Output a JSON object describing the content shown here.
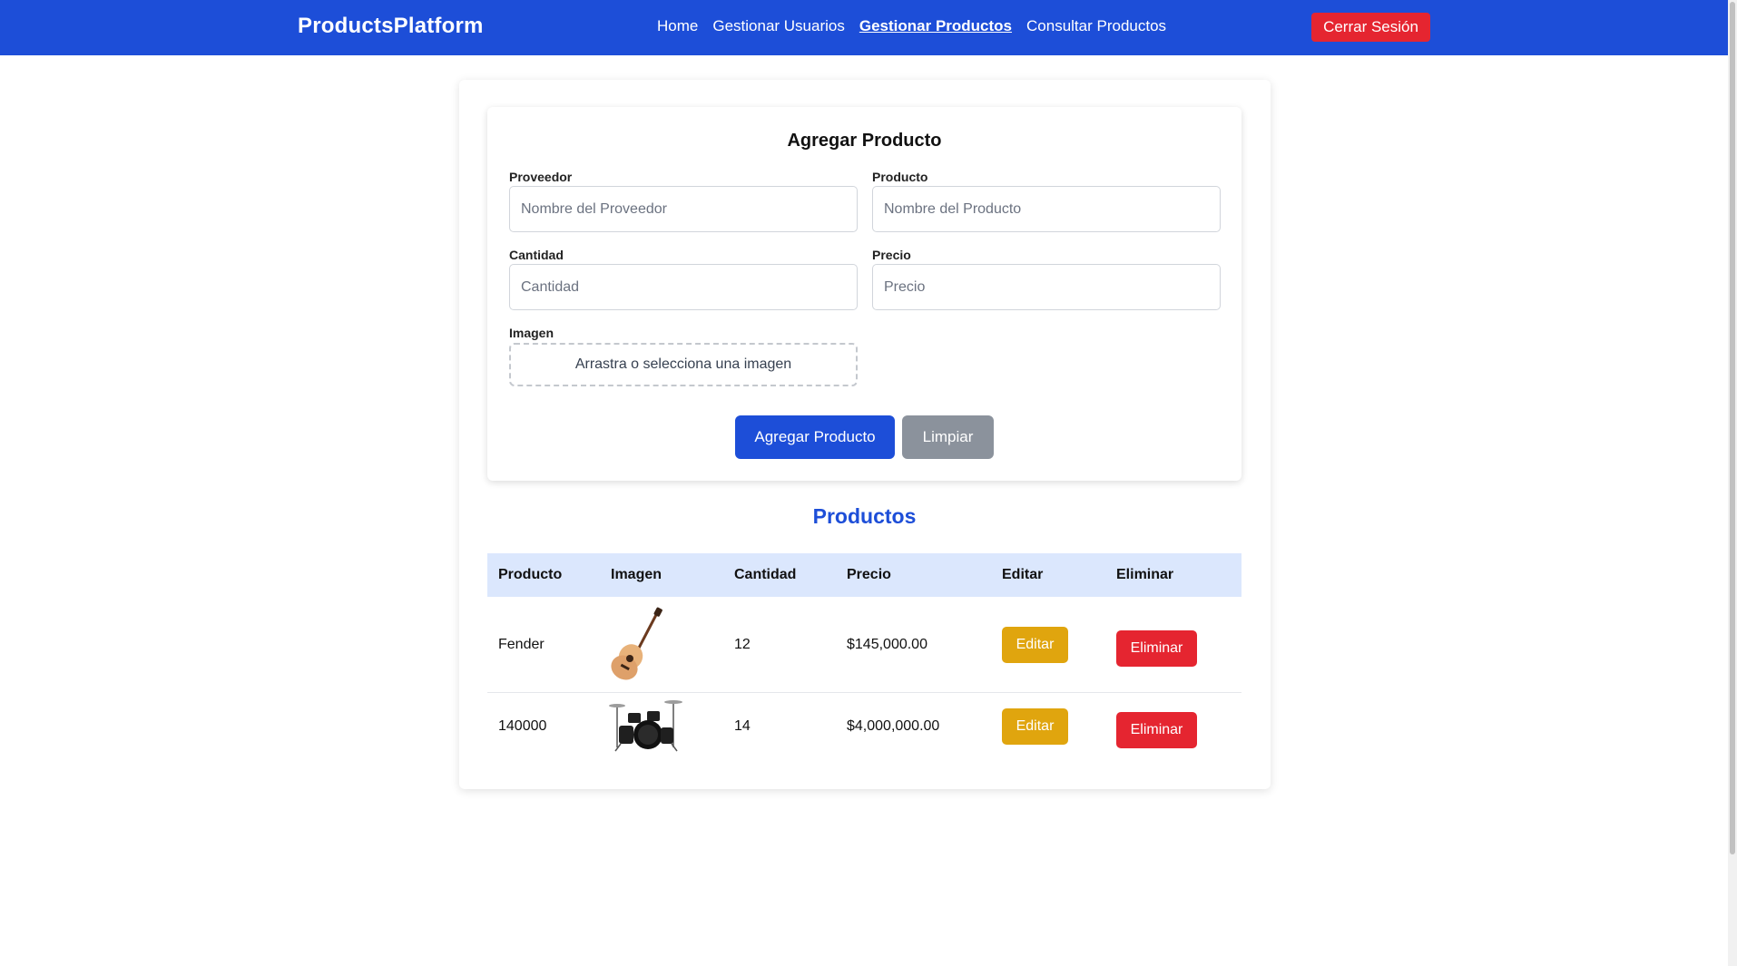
{
  "navbar": {
    "brand": "ProductsPlatform",
    "links": [
      {
        "label": "Home",
        "active": false
      },
      {
        "label": "Gestionar Usuarios",
        "active": false
      },
      {
        "label": "Gestionar Productos",
        "active": true
      },
      {
        "label": "Consultar Productos",
        "active": false
      }
    ],
    "logout_label": "Cerrar Sesión"
  },
  "form": {
    "title": "Agregar Producto",
    "fields": {
      "proveedor": {
        "label": "Proveedor",
        "placeholder": "Nombre del Proveedor",
        "value": ""
      },
      "producto": {
        "label": "Producto",
        "placeholder": "Nombre del Producto",
        "value": ""
      },
      "cantidad": {
        "label": "Cantidad",
        "placeholder": "Cantidad",
        "value": ""
      },
      "precio": {
        "label": "Precio",
        "placeholder": "Precio",
        "value": ""
      },
      "imagen": {
        "label": "Imagen",
        "dropzone_text": "Arrastra o selecciona una imagen"
      }
    },
    "submit_label": "Agregar Producto",
    "clear_label": "Limpiar"
  },
  "products": {
    "title": "Productos",
    "columns": [
      "Producto",
      "Imagen",
      "Cantidad",
      "Precio",
      "Editar",
      "Eliminar"
    ],
    "rows": [
      {
        "producto": "Fender",
        "image_icon": "acoustic-guitar-icon",
        "cantidad": "12",
        "precio": "$145,000.00",
        "edit_label": "Editar",
        "delete_label": "Eliminar"
      },
      {
        "producto": "140000",
        "image_icon": "drum-kit-icon",
        "cantidad": "14",
        "precio": "$4,000,000.00",
        "edit_label": "Editar",
        "delete_label": "Eliminar"
      }
    ]
  },
  "colors": {
    "primary": "#1d4ed8",
    "danger": "#e52530",
    "warning": "#e0a50e",
    "secondary": "#8b929c",
    "table_header": "#dbe7fd"
  }
}
